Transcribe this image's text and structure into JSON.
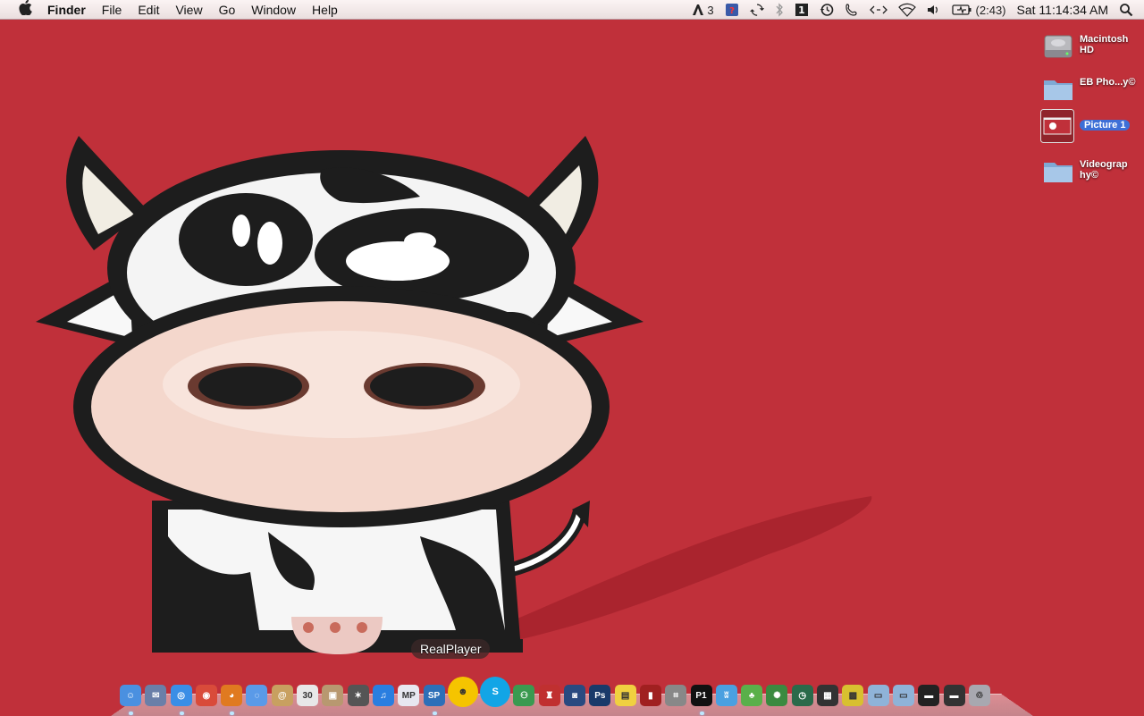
{
  "menubar": {
    "app_name": "Finder",
    "menus": [
      "File",
      "Edit",
      "View",
      "Go",
      "Window",
      "Help"
    ],
    "status": {
      "adobe_count": "3",
      "battery_time": "(2:43)",
      "clock": "Sat 11:14:34 AM"
    },
    "icons": [
      "apple-icon",
      "adobe-updater-icon",
      "notification-badge-icon",
      "sync-icon",
      "bluetooth-icon",
      "spaces-icon",
      "time-machine-icon",
      "phone-icon",
      "network-arrows-icon",
      "wifi-icon",
      "volume-icon",
      "battery-icon",
      "spotlight-icon"
    ]
  },
  "desktop": {
    "items": [
      {
        "label": "Macintosh HD",
        "icon": "hard-drive-icon"
      },
      {
        "label": "EB Pho...y©",
        "icon": "folder-icon"
      },
      {
        "label": "Picture 1",
        "icon": "screenshot-thumbnail-icon",
        "selected": true
      },
      {
        "label": "Videograp hy©",
        "icon": "folder-icon"
      }
    ]
  },
  "dock": {
    "tooltip": "RealPlayer",
    "apps": [
      {
        "icon": "finder-icon",
        "color": "#4a90e0",
        "glyph": "☺"
      },
      {
        "icon": "mail-stamp-icon",
        "color": "#6a7fa8",
        "glyph": "✉"
      },
      {
        "icon": "safari-icon",
        "color": "#3a8ee6",
        "glyph": "◎"
      },
      {
        "icon": "chrome-icon",
        "color": "#d94b3a",
        "glyph": "◉"
      },
      {
        "icon": "firefox-icon",
        "color": "#e07a20",
        "glyph": "◕"
      },
      {
        "icon": "ichat-icon",
        "color": "#5a9ae8",
        "glyph": "◌"
      },
      {
        "icon": "address-book-icon",
        "color": "#c8a060",
        "glyph": "@"
      },
      {
        "icon": "ical-icon",
        "color": "#e8e8e8",
        "glyph": "30"
      },
      {
        "icon": "preview-icon",
        "color": "#b89870",
        "glyph": "▣"
      },
      {
        "icon": "star-app-icon",
        "color": "#555",
        "glyph": "✶"
      },
      {
        "icon": "itunes-icon",
        "color": "#2a7ee0",
        "glyph": "♫"
      },
      {
        "icon": "mplayer-icon",
        "color": "#e8e8f0",
        "glyph": "MP"
      },
      {
        "icon": "realplayer-icon",
        "color": "#2d6fb8",
        "glyph": "SP"
      },
      {
        "icon": "yahoo-messenger-icon",
        "color": "#f5c400",
        "glyph": "☻",
        "big": true
      },
      {
        "icon": "skype-icon",
        "color": "#12a5e6",
        "glyph": "S",
        "big": true
      },
      {
        "icon": "messenger-icon",
        "color": "#3a9a50",
        "glyph": "⚇"
      },
      {
        "icon": "joystick-icon",
        "color": "#c03030",
        "glyph": "♜"
      },
      {
        "icon": "photo-booth-icon",
        "color": "#2a4a80",
        "glyph": "◙"
      },
      {
        "icon": "photoshop-icon",
        "color": "#1a3a6a",
        "glyph": "Ps"
      },
      {
        "icon": "stickies-icon",
        "color": "#f0d040",
        "glyph": "▤"
      },
      {
        "icon": "red-book-icon",
        "color": "#a02020",
        "glyph": "▮"
      },
      {
        "icon": "screenshot-app-icon",
        "color": "#888",
        "glyph": "⌗"
      },
      {
        "icon": "p1-icon",
        "color": "#111",
        "glyph": "P1"
      },
      {
        "icon": "waves-icon",
        "color": "#4aa0e0",
        "glyph": "ʬ"
      },
      {
        "icon": "frog-icon",
        "color": "#5ab04a",
        "glyph": "♣"
      },
      {
        "icon": "fan-icon",
        "color": "#3a8a40",
        "glyph": "✺"
      },
      {
        "icon": "time-machine-dock-icon",
        "color": "#2a6a4a",
        "glyph": "◷"
      },
      {
        "icon": "clapper-icon",
        "color": "#333",
        "glyph": "▦"
      },
      {
        "icon": "chess-icon",
        "color": "#d8c030",
        "glyph": "▩"
      },
      {
        "icon": "applications-folder-icon",
        "color": "#8fb3d8",
        "glyph": "▭"
      },
      {
        "icon": "documents-folder-icon",
        "color": "#8fb3d8",
        "glyph": "▭"
      },
      {
        "icon": "monitor-icon",
        "color": "#222",
        "glyph": "▬"
      },
      {
        "icon": "display-icon",
        "color": "#333",
        "glyph": "▬"
      },
      {
        "icon": "trash-icon",
        "color": "#a8a8b0",
        "glyph": "♲"
      }
    ]
  }
}
